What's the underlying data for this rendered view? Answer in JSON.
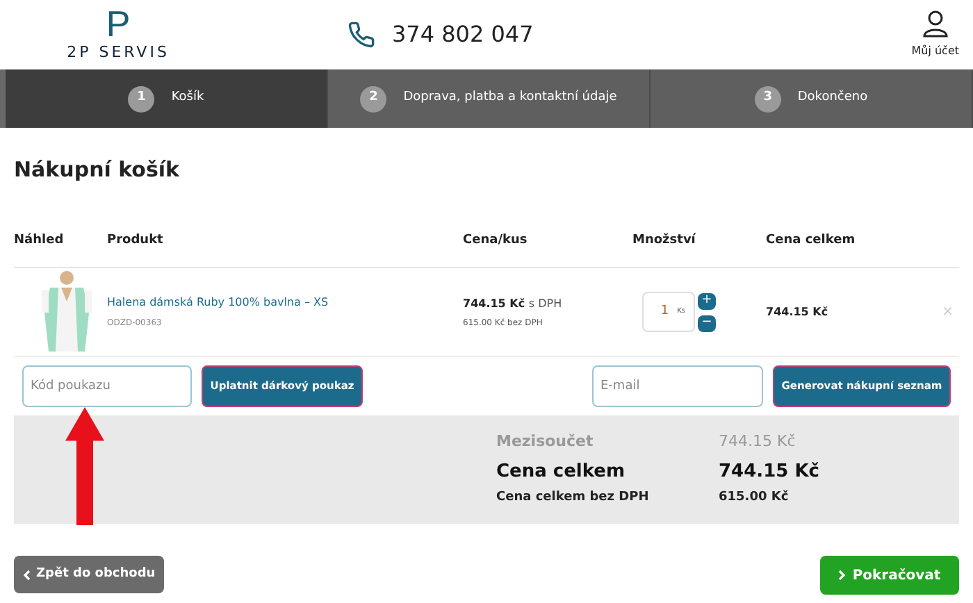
{
  "header": {
    "logo_mark": "P",
    "logo_text": "2P SERVIS",
    "phone": "374 802 047",
    "account": "Můj účet"
  },
  "steps": [
    {
      "number": "1",
      "label": "Košík",
      "selected": true
    },
    {
      "number": "2",
      "label": "Doprava, platba a kontaktní údaje",
      "selected": false
    },
    {
      "number": "3",
      "label": "Dokončeno",
      "selected": false
    }
  ],
  "title": "Nákupní košík",
  "table": {
    "columns": [
      "Náhled",
      "Produkt",
      "Cena/kus",
      "Množství",
      "Cena celkem"
    ],
    "rows": [
      {
        "name": "Halena dámská Ruby 100% bavlna – XS",
        "code": "ODZD-00363",
        "price": "744.15 Kč",
        "price_suffix": "s DPH",
        "price_net": "615.00 Kč bez DPH",
        "quantity": "1",
        "unit": "Ks",
        "plus": "+",
        "minus": "−",
        "total": "744.15 Kč",
        "remove": "×"
      }
    ]
  },
  "voucher": {
    "placeholder": "Kód poukazu",
    "button": "Uplatnit dárkový poukaz"
  },
  "email": {
    "placeholder": "E-mail",
    "button": "Generovat nákupní seznam"
  },
  "summary": [
    {
      "kind": "muted",
      "label": "Mezisoučet",
      "value": "744.15 Kč"
    },
    {
      "kind": "total",
      "label": "Cena celkem",
      "value": "744.15 Kč"
    },
    {
      "kind": "small",
      "label": "Cena celkem bez DPH",
      "value": "615.00 Kč"
    }
  ],
  "back_button": "Zpět do obchodu",
  "continue_button": "Pokračovat"
}
